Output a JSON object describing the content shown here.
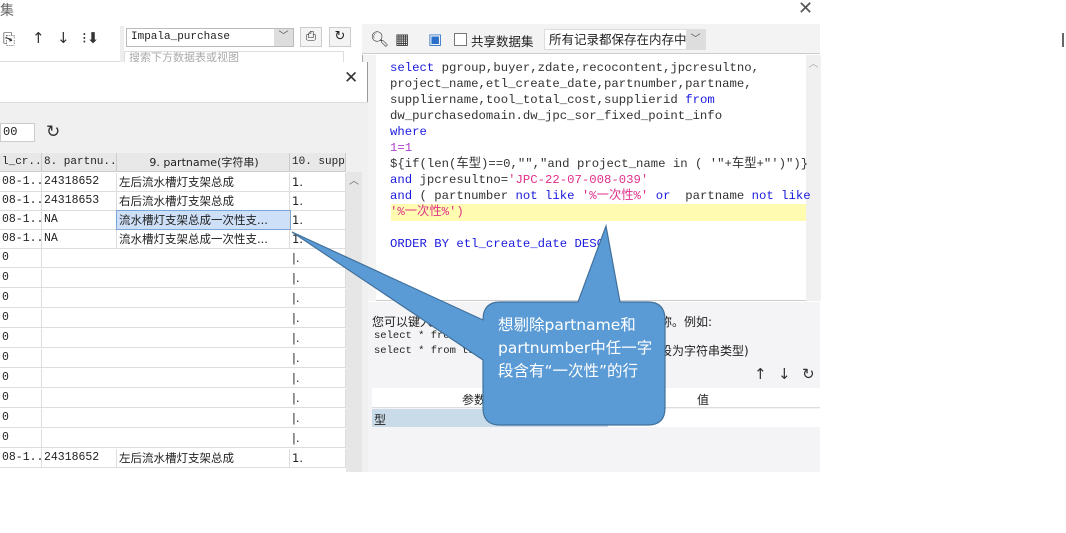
{
  "window_title_fragment": "集",
  "left_toolbar": {
    "icons": [
      "copy-icon",
      "move-up-icon",
      "move-down-icon",
      "sort-down-icon"
    ]
  },
  "datasource": {
    "selected": "Impala_purchase",
    "search_placeholder": "搜索下方数据表或视图"
  },
  "right_toolbar": {
    "share_label": "共享数据集",
    "share_checked": false,
    "storage_mode": "所有记录都保存在内存中"
  },
  "sql_lines": [
    "select pgroup,buyer,zdate,recocontent,jpcresultno,",
    "project_name,etl_create_date,partnumber,partname,",
    "suppliername,tool_total_cost,supplierid from",
    "dw_purchasedomain.dw_jpc_sor_fixed_point_info",
    "where",
    "1=1",
    "${if(len(车型)==0,\"\",\"and project_name in ( '\"+车型+\"')\")}",
    "and jpcresultno='JPC-22-07-008-039'",
    "and ( partnumber not like '%一次性%' or  partname not like",
    "'%一次性%')",
    "",
    "ORDER BY etl_create_date DESC"
  ],
  "help": {
    "line1": "您可以键入",
    "line1_end": "称。例如:",
    "line2": "select * from",
    "line3": "select * from tab",
    "line3_end": "设为字符串类型)"
  },
  "params_table": {
    "headers": [
      "参数",
      "值"
    ],
    "rows": [
      {
        "name": "型",
        "value": ""
      }
    ]
  },
  "preview": {
    "limit_value": "00",
    "headers": [
      "l_cr...",
      "8. partnu...",
      "9. partname(字符串)",
      "10. suppl"
    ],
    "rows": [
      [
        "08-1...",
        "24318652",
        "左后流水槽灯支架总成",
        "1."
      ],
      [
        "08-1...",
        "24318653",
        "右后流水槽灯支架总成",
        "1."
      ],
      [
        "08-1...",
        "NA",
        "流水槽灯支架总成一次性支...",
        "1."
      ],
      [
        "08-1...",
        "NA",
        "流水槽灯支架总成一次性支...",
        "1."
      ]
    ],
    "empty_row_prefix": "0",
    "last_row": [
      "08-1...",
      "24318652",
      "左后流水槽灯支架总成",
      "1."
    ]
  },
  "callout": {
    "text": "想剔除partname和partnumber中任一字段含有“一次性”的行",
    "color": "#5b9bd5"
  }
}
